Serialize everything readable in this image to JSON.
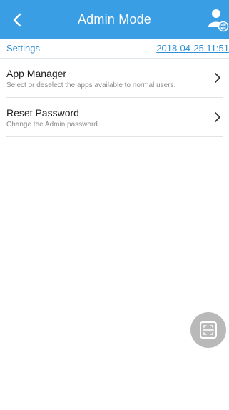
{
  "header": {
    "title": "Admin Mode",
    "back_icon": "back-chevron-icon",
    "user_icon": "user-switch-icon",
    "background": "#3a9ee4"
  },
  "subheader": {
    "section_label": "Settings",
    "datetime": "2018-04-25 11:51",
    "link_color": "#2f8fd6"
  },
  "items": [
    {
      "title": "App Manager",
      "description": "Select or deselect the apps available to normal users.",
      "icon": "chevron-right-icon"
    },
    {
      "title": "Reset Password",
      "description": "Change the Admin password.",
      "icon": "chevron-right-icon"
    }
  ],
  "fab": {
    "icon": "scan-icon",
    "background": "#b9b9b9"
  }
}
